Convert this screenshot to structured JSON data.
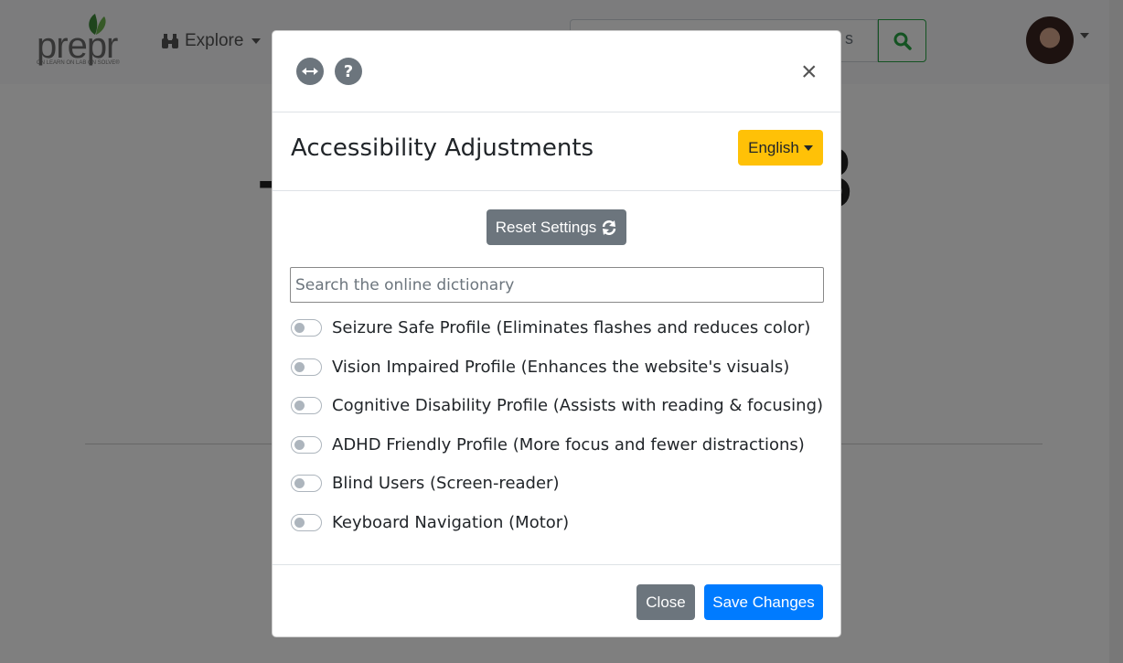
{
  "app": {
    "logo_text": "prepr",
    "logo_tagline": "ON LEARN ON LAB ON SOLVE®",
    "nav_explore_label": "Explore",
    "search_partial": "s",
    "heading_left_char": "-",
    "heading_right_char": "3",
    "brand_green": "#28a745"
  },
  "modal": {
    "icons": [
      "arrows-horizontal-icon",
      "question-icon"
    ],
    "close_symbol": "×",
    "title": "Accessibility Adjustments",
    "language_label": "English",
    "reset_label": "Reset Settings",
    "dictionary_placeholder": "Search the online dictionary",
    "profiles": [
      {
        "label": "Seizure Safe Profile (Eliminates flashes and reduces color)",
        "enabled": false
      },
      {
        "label": "Vision Impaired Profile (Enhances the website's visuals)",
        "enabled": false
      },
      {
        "label": "Cognitive Disability Profile (Assists with reading & focusing)",
        "enabled": false
      },
      {
        "label": "ADHD Friendly Profile (More focus and fewer distractions)",
        "enabled": false
      },
      {
        "label": "Blind Users (Screen-reader)",
        "enabled": false
      },
      {
        "label": "Keyboard Navigation (Motor)",
        "enabled": false
      }
    ],
    "close_label": "Close",
    "save_label": "Save Changes",
    "colors": {
      "language_button": "#ffc107",
      "secondary": "#6c757d",
      "primary": "#007bff"
    }
  }
}
